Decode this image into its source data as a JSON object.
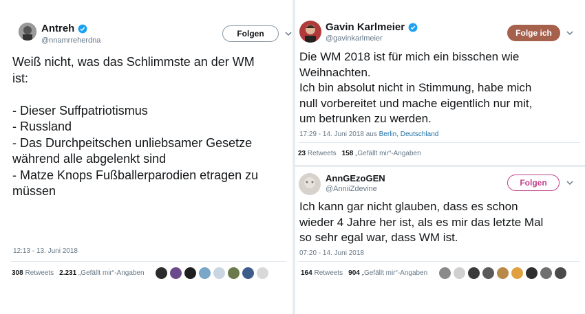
{
  "tweets": [
    {
      "name": "Antreh",
      "handle": "@nnamrreherdna",
      "button": "Folgen",
      "text": "Weiß nicht, was das Schlimmste an der WM\nist:\n\n- Dieser Suffpatriotismus\n- Russland\n- Das Durchpeitschen unliebsamer Gesetze\nwährend alle abgelenkt sind\n- Matze Knops Fußballerparodien etragen zu\nmüssen",
      "timestamp": "12:13 - 13. Juni 2018",
      "retweets": "308",
      "retweets_label": "Retweets",
      "likes": "2.231",
      "likes_label": "„Gefällt mir“-Angaben",
      "liker_colors": [
        "#2b2b2b",
        "#6a4a8a",
        "#1f1f1f",
        "#7aa7c7",
        "#c9d5e0",
        "#6b7a4a",
        "#3d5c8a",
        "#d9d9d9"
      ]
    },
    {
      "name": "Gavin Karlmeier",
      "handle": "@gavinkarlmeier",
      "button": "Folge ich",
      "text": "Die WM 2018 ist für mich ein bisschen wie\nWeihnachten.\nIch bin absolut nicht in Stimmung, habe mich\nnull vorbereitet und mache eigentlich nur mit,\num betrunken zu werden.",
      "timestamp": "17:29 - 14. Juni 2018 aus ",
      "location": "Berlin, Deutschland",
      "retweets": "23",
      "retweets_label": "Retweets",
      "likes": "158",
      "likes_label": "„Gefällt mir“-Angaben"
    },
    {
      "name": "AnnGEzoGEN",
      "handle": "@AnniiZdevine",
      "button": "Folgen",
      "text": "Ich kann gar nicht glauben, dass es schon\nwieder 4 Jahre her ist, als es mir das letzte Mal\nso sehr egal war, dass WM ist.",
      "timestamp": "07:20 - 14. Juni 2018",
      "retweets": "164",
      "retweets_label": "Retweets",
      "likes": "904",
      "likes_label": "„Gefällt mir“-Angaben",
      "liker_colors": [
        "#8a8a8a",
        "#d0d0d0",
        "#3a3a3a",
        "#5a5a5a",
        "#b88a4a",
        "#e0a040",
        "#2e2e2e",
        "#707070",
        "#4a4a4a"
      ]
    }
  ]
}
